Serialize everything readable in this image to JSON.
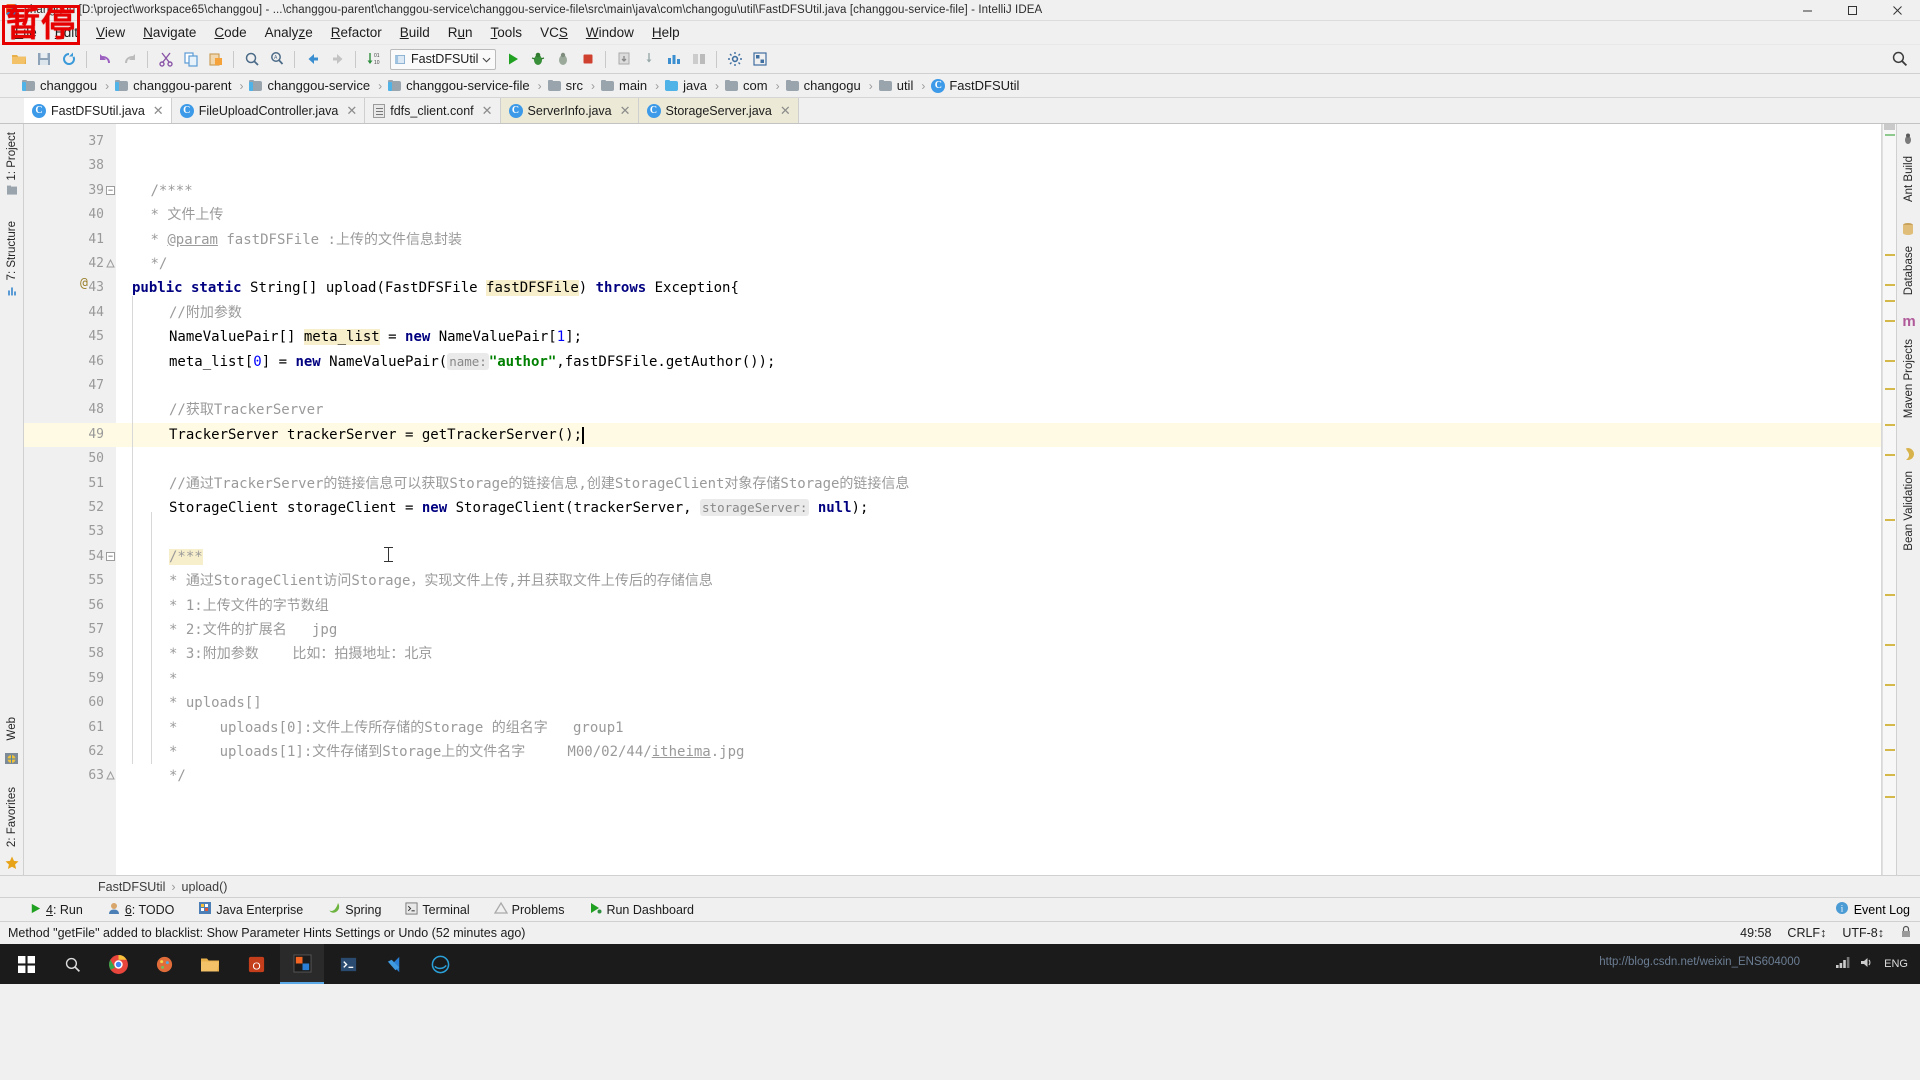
{
  "window": {
    "title": "changgou [D:\\project\\workspace65\\changgou] - ...\\changgou-parent\\changgou-service\\changgou-service-file\\src\\main\\java\\com\\changogu\\util\\FastDFSUtil.java [changgou-service-file] - IntelliJ IDEA",
    "minimize": "—",
    "maximize": "□",
    "close": "✕"
  },
  "watermark": {
    "stamp": "暂停",
    "url": "http://blog.csdn.net/weixin_ENS604000"
  },
  "menu": [
    {
      "label": "File",
      "accel": "F"
    },
    {
      "label": "Edit",
      "accel": "E"
    },
    {
      "label": "View",
      "accel": "V"
    },
    {
      "label": "Navigate",
      "accel": "N"
    },
    {
      "label": "Code",
      "accel": "C"
    },
    {
      "label": "Analyze",
      "accel": "z"
    },
    {
      "label": "Refactor",
      "accel": "R"
    },
    {
      "label": "Build",
      "accel": "B"
    },
    {
      "label": "Run",
      "accel": "u"
    },
    {
      "label": "Tools",
      "accel": "T"
    },
    {
      "label": "VCS",
      "accel": "S"
    },
    {
      "label": "Window",
      "accel": "W"
    },
    {
      "label": "Help",
      "accel": "H"
    }
  ],
  "toolbar": {
    "run_config": "FastDFSUtil",
    "icons": [
      "open-folder-icon",
      "save-all-icon",
      "sync-icon",
      "undo-icon",
      "redo-icon",
      "cut-icon",
      "copy-icon",
      "paste-icon",
      "find-icon",
      "replace-icon",
      "back-icon",
      "forward-icon",
      "sort-icon"
    ],
    "run_icons": [
      "run-icon",
      "debug-icon",
      "run-coverage-icon",
      "stop-icon"
    ],
    "extra_icons": [
      "update-project-icon",
      "commit-icon",
      "structure-icon",
      "compare-icon",
      "settings-icon",
      "project-structure-icon",
      "search-everywhere-icon"
    ],
    "search_icon": "search-icon"
  },
  "breadcrumbs": [
    {
      "label": "changgou",
      "icon": "module-folder-icon"
    },
    {
      "label": "changgou-parent",
      "icon": "module-folder-icon"
    },
    {
      "label": "changgou-service",
      "icon": "module-folder-icon"
    },
    {
      "label": "changgou-service-file",
      "icon": "module-folder-icon"
    },
    {
      "label": "src",
      "icon": "folder-icon"
    },
    {
      "label": "main",
      "icon": "folder-icon"
    },
    {
      "label": "java",
      "icon": "source-folder-icon"
    },
    {
      "label": "com",
      "icon": "package-folder-icon"
    },
    {
      "label": "changogu",
      "icon": "package-folder-icon"
    },
    {
      "label": "util",
      "icon": "package-folder-icon"
    },
    {
      "label": "FastDFSUtil",
      "icon": "class-icon"
    }
  ],
  "tabs": [
    {
      "label": "FastDFSUtil.java",
      "icon": "java-class-icon",
      "state": "active"
    },
    {
      "label": "FileUploadController.java",
      "icon": "java-class-icon",
      "state": "normal"
    },
    {
      "label": "fdfs_client.conf",
      "icon": "config-file-icon",
      "state": "normal"
    },
    {
      "label": "ServerInfo.java",
      "icon": "java-class-icon",
      "state": "highlight"
    },
    {
      "label": "StorageServer.java",
      "icon": "java-class-icon",
      "state": "highlight"
    }
  ],
  "left_rail": [
    {
      "label": "1: Project",
      "icon": "project-icon"
    },
    {
      "label": "7: Structure",
      "icon": "structure-icon"
    },
    {
      "label": "2: Favorites",
      "icon": "favorites-icon"
    },
    {
      "label": "Web",
      "icon": "web-icon"
    }
  ],
  "right_rail": [
    {
      "label": "Ant Build",
      "icon": "ant-icon"
    },
    {
      "label": "Database",
      "icon": "database-icon"
    },
    {
      "label": "Maven Projects",
      "icon": "maven-icon"
    },
    {
      "label": "Bean Validation",
      "icon": "bean-icon"
    }
  ],
  "editor": {
    "first_line_number": 37,
    "current_line": 49,
    "lines": [
      {
        "n": 37,
        "tokens": []
      },
      {
        "n": 38,
        "tokens": []
      },
      {
        "n": 39,
        "indent": 1,
        "tokens": [
          {
            "t": "/****",
            "c": "cmt"
          }
        ],
        "fold": "open"
      },
      {
        "n": 40,
        "indent": 1,
        "tokens": [
          {
            "t": "* 文件上传",
            "c": "cmt"
          }
        ]
      },
      {
        "n": 41,
        "indent": 1,
        "tokens": [
          {
            "t": "* ",
            "c": "cmt"
          },
          {
            "t": "@param",
            "c": "cmt u"
          },
          {
            "t": " fastDFSFile :上传的文件信息封装",
            "c": "cmt"
          }
        ]
      },
      {
        "n": 42,
        "indent": 1,
        "tokens": [
          {
            "t": "*/",
            "c": "cmt"
          }
        ],
        "fold": "close"
      },
      {
        "n": 43,
        "indent": 0,
        "annotation": "@",
        "tokens": [
          {
            "t": "public static ",
            "c": "kw"
          },
          {
            "t": "String[] upload(FastDFSFile ",
            "c": "plain"
          },
          {
            "t": "fastDFSFile",
            "c": "hl-ident"
          },
          {
            "t": ") ",
            "c": "plain"
          },
          {
            "t": "throws ",
            "c": "kw"
          },
          {
            "t": "Exception{",
            "c": "plain"
          }
        ]
      },
      {
        "n": 44,
        "indent": 2,
        "tokens": [
          {
            "t": "//附加参数",
            "c": "cmt"
          }
        ]
      },
      {
        "n": 45,
        "indent": 2,
        "tokens": [
          {
            "t": "NameValuePair[] ",
            "c": "plain"
          },
          {
            "t": "meta_list",
            "c": "hl-ident"
          },
          {
            "t": " = ",
            "c": "plain"
          },
          {
            "t": "new ",
            "c": "kw"
          },
          {
            "t": "NameValuePair[",
            "c": "plain"
          },
          {
            "t": "1",
            "c": "num"
          },
          {
            "t": "];",
            "c": "plain"
          }
        ]
      },
      {
        "n": 46,
        "indent": 2,
        "tokens": [
          {
            "t": "meta_list[",
            "c": "plain"
          },
          {
            "t": "0",
            "c": "num"
          },
          {
            "t": "] = ",
            "c": "plain"
          },
          {
            "t": "new ",
            "c": "kw"
          },
          {
            "t": "NameValuePair(",
            "c": "plain"
          },
          {
            "t": "name:",
            "c": "hint"
          },
          {
            "t": "\"author\"",
            "c": "str"
          },
          {
            "t": ",fastDFSFile.getAuthor());",
            "c": "plain"
          }
        ]
      },
      {
        "n": 47,
        "indent": 2,
        "tokens": []
      },
      {
        "n": 48,
        "indent": 2,
        "tokens": [
          {
            "t": "//获取TrackerServer",
            "c": "cmt"
          }
        ]
      },
      {
        "n": 49,
        "indent": 2,
        "tokens": [
          {
            "t": "TrackerServer trackerServer = getTrackerServer();",
            "c": "plain"
          }
        ],
        "current": true
      },
      {
        "n": 50,
        "indent": 2,
        "tokens": []
      },
      {
        "n": 51,
        "indent": 2,
        "tokens": [
          {
            "t": "//通过TrackerServer的链接信息可以获取Storage的链接信息,创建StorageClient对象存储Storage的链接信息",
            "c": "cmt"
          }
        ]
      },
      {
        "n": 52,
        "indent": 2,
        "tokens": [
          {
            "t": "StorageClient storageClient = ",
            "c": "plain"
          },
          {
            "t": "new ",
            "c": "kw"
          },
          {
            "t": "StorageClient(trackerServer, ",
            "c": "plain"
          },
          {
            "t": "storageServer:",
            "c": "hint"
          },
          {
            "t": " ",
            "c": "plain"
          },
          {
            "t": "null",
            "c": "kw"
          },
          {
            "t": ");",
            "c": "plain"
          }
        ]
      },
      {
        "n": 53,
        "indent": 2,
        "tokens": []
      },
      {
        "n": 54,
        "indent": 2,
        "tokens": [
          {
            "t": "/***",
            "c": "cmt hl-ident"
          }
        ],
        "fold": "open"
      },
      {
        "n": 55,
        "indent": 2,
        "tokens": [
          {
            "t": "* 通过StorageClient访问Storage，实现文件上传,并且获取文件上传后的存储信息",
            "c": "cmt"
          }
        ]
      },
      {
        "n": 56,
        "indent": 2,
        "tokens": [
          {
            "t": "* 1:上传文件的字节数组",
            "c": "cmt"
          }
        ]
      },
      {
        "n": 57,
        "indent": 2,
        "tokens": [
          {
            "t": "* 2:文件的扩展名   jpg",
            "c": "cmt"
          }
        ]
      },
      {
        "n": 58,
        "indent": 2,
        "tokens": [
          {
            "t": "* 3:附加参数    比如：拍摄地址：北京",
            "c": "cmt"
          }
        ]
      },
      {
        "n": 59,
        "indent": 2,
        "tokens": [
          {
            "t": "*",
            "c": "cmt"
          }
        ]
      },
      {
        "n": 60,
        "indent": 2,
        "tokens": [
          {
            "t": "* uploads[]",
            "c": "cmt"
          }
        ]
      },
      {
        "n": 61,
        "indent": 2,
        "tokens": [
          {
            "t": "*     uploads[0]:文件上传所存储的Storage 的组名字   group1",
            "c": "cmt"
          }
        ]
      },
      {
        "n": 62,
        "indent": 2,
        "tokens": [
          {
            "t": "*     uploads[1]:文件存储到Storage上的文件名字     M00/02/44/",
            "c": "cmt"
          },
          {
            "t": "itheima",
            "c": "cmt u"
          },
          {
            "t": ".jpg",
            "c": "cmt"
          }
        ]
      },
      {
        "n": 63,
        "indent": 2,
        "tokens": [
          {
            "t": "*/",
            "c": "cmt"
          }
        ],
        "fold": "close"
      }
    ]
  },
  "editor_breadcrumb": {
    "class": "FastDFSUtil",
    "separator": "›",
    "method": "upload()"
  },
  "tool_windows": [
    {
      "num": "4",
      "label": "Run",
      "icon": "run-icon"
    },
    {
      "num": "6",
      "label": "TODO",
      "icon": "todo-icon"
    },
    {
      "num": "",
      "label": "Java Enterprise",
      "icon": "java-ee-icon"
    },
    {
      "num": "",
      "label": "Spring",
      "icon": "spring-icon"
    },
    {
      "num": "",
      "label": "Terminal",
      "icon": "terminal-icon"
    },
    {
      "num": "",
      "label": "Problems",
      "icon": "problems-icon"
    },
    {
      "num": "",
      "label": "Run Dashboard",
      "icon": "run-dashboard-icon"
    }
  ],
  "event_log": {
    "label": "Event Log",
    "icon": "event-log-icon"
  },
  "status_bar": {
    "message": "Method \"getFile\" added to blacklist: Show Parameter Hints Settings or Undo (52 minutes ago)",
    "position": "49:58",
    "line_ending": "CRLF↕",
    "encoding": "UTF-8↕",
    "lock_icon": "lock-icon"
  },
  "taskbar": {
    "items": [
      "start-icon",
      "search-icon",
      "chrome-icon",
      "paint-icon",
      "explorer-icon",
      "office-icon",
      "idea-icon",
      "terminal-icon",
      "vscode-icon",
      "edge-icon"
    ],
    "tray_time": "",
    "tray_icons": [
      "network-icon",
      "volume-icon",
      "ime-icon"
    ]
  },
  "colors": {
    "keyword": "#000080",
    "comment": "#9a9a9a",
    "string": "#008000",
    "number": "#0000ff",
    "highlight": "#f7eecb",
    "current_line": "#fffae3",
    "accent": "#4fb3e8",
    "stamp_red": "#e60000"
  }
}
